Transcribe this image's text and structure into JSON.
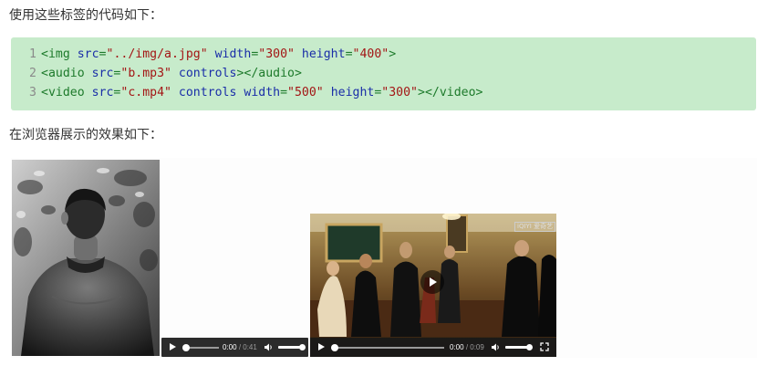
{
  "intro_text": "使用这些标签的代码如下：",
  "code": {
    "lines": [
      {
        "num": "1",
        "tag_open": "<img",
        "a1": "src",
        "v1": "\"../img/a.jpg\"",
        "a2": "width",
        "v2": "\"300\"",
        "a3": "height",
        "v3": "\"400\"",
        "close": ">"
      },
      {
        "num": "2",
        "tag_open": "<audio",
        "a1": "src",
        "v1": "\"b.mp3\"",
        "a2": "controls",
        "close": "></audio>"
      },
      {
        "num": "3",
        "tag_open": "<video",
        "a1": "src",
        "v1": "\"c.mp4\"",
        "a2": "controls",
        "a3": "width",
        "v3": "\"500\"",
        "a4": "height",
        "v4": "\"300\"",
        "close": "></video>"
      }
    ]
  },
  "result_text": "在浏览器展示的效果如下：",
  "audio_player": {
    "current_time": "0:00",
    "duration": "/ 0:41",
    "progress": 0.0,
    "volume": 1.0
  },
  "video_player": {
    "current_time": "0:00",
    "duration": "/ 0:09",
    "progress": 0.0,
    "volume": 1.0,
    "watermark": "iQIYI 爱奇艺"
  },
  "colors": {
    "code_bg": "#c7ebcb",
    "tag": "#1d7a2b",
    "attr": "#1a2ea8",
    "string": "#a31515",
    "player_bar": "#2b2b2b"
  },
  "icons": [
    "play-icon",
    "volume-icon",
    "fullscreen-icon"
  ]
}
